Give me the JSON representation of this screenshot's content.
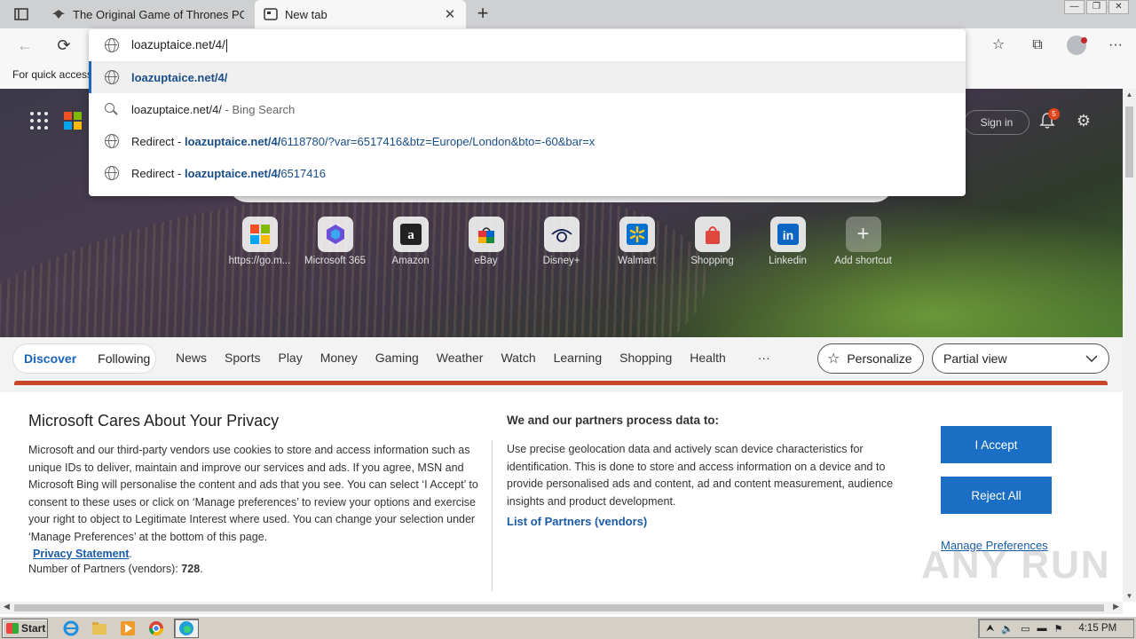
{
  "tabs": [
    {
      "title": "The Original Game of Thrones PC",
      "active": false
    },
    {
      "title": "New tab",
      "active": true
    }
  ],
  "omnibox": {
    "input_value": "loazuptaice.net/4/",
    "suggestions": [
      {
        "highlight": "loazuptaice.net/4/",
        "rest": ""
      },
      {
        "main": "loazuptaice.net/4/",
        "suffix": " - Bing Search"
      },
      {
        "prefix": "Redirect - ",
        "highlight": "loazuptaice.net/4/",
        "rest": "6118780/?var=6517416&btz=Europe/London&bto=-60&bar=x"
      },
      {
        "prefix": "Redirect - ",
        "highlight": "loazuptaice.net/4/",
        "rest": "6517416"
      }
    ]
  },
  "favorites_bar": {
    "text": "For quick access"
  },
  "header": {
    "sign_in": "Sign in",
    "notification_count": "5"
  },
  "shortcuts": [
    {
      "label": "https://go.m...",
      "icon": "windows-tile-icon"
    },
    {
      "label": "Microsoft 365",
      "icon": "m365-icon"
    },
    {
      "label": "Amazon",
      "icon": "amazon-icon"
    },
    {
      "label": "eBay",
      "icon": "ebay-icon"
    },
    {
      "label": "Disney+",
      "icon": "disney-icon"
    },
    {
      "label": "Walmart",
      "icon": "walmart-icon"
    },
    {
      "label": "Shopping",
      "icon": "shopping-bag-icon"
    },
    {
      "label": "Linkedin",
      "icon": "linkedin-icon"
    },
    {
      "label": "Add shortcut",
      "icon": "plus-icon"
    }
  ],
  "feed_nav": {
    "discover": "Discover",
    "following": "Following",
    "links": [
      "News",
      "Sports",
      "Play",
      "Money",
      "Gaming",
      "Weather",
      "Watch",
      "Learning",
      "Shopping",
      "Health",
      "···"
    ],
    "personalize": "Personalize",
    "view_select": "Partial view"
  },
  "privacy": {
    "title": "Microsoft Cares About Your Privacy",
    "left_body": "Microsoft and our third-party vendors use cookies to store and access information such as unique IDs to deliver, maintain and improve our services and ads. If you agree, MSN and Microsoft Bing will personalise the content and ads that you see. You can select ‘I Accept’ to consent to these uses or click on ‘Manage preferences’ to review your options and exercise your right to object to Legitimate Interest where used.  You can change your selection under ‘Manage Preferences’ at the bottom of this page.",
    "privacy_link": "Privacy Statement",
    "partners_label": "Number of Partners (vendors): ",
    "partners_count": "728",
    "right_title": "We and our partners process data to:",
    "right_body": "Use precise geolocation data and actively scan device characteristics for identification. This is done to store and access information on a device and to provide personalised ads and content, ad and content measurement, audience insights and product development.",
    "vendors_link": "List of Partners (vendors)",
    "accept": "I Accept",
    "reject": "Reject All",
    "manage": "Manage Preferences"
  },
  "watermark": "ANY RUN",
  "taskbar": {
    "start": "Start",
    "clock": "4:15 PM"
  }
}
